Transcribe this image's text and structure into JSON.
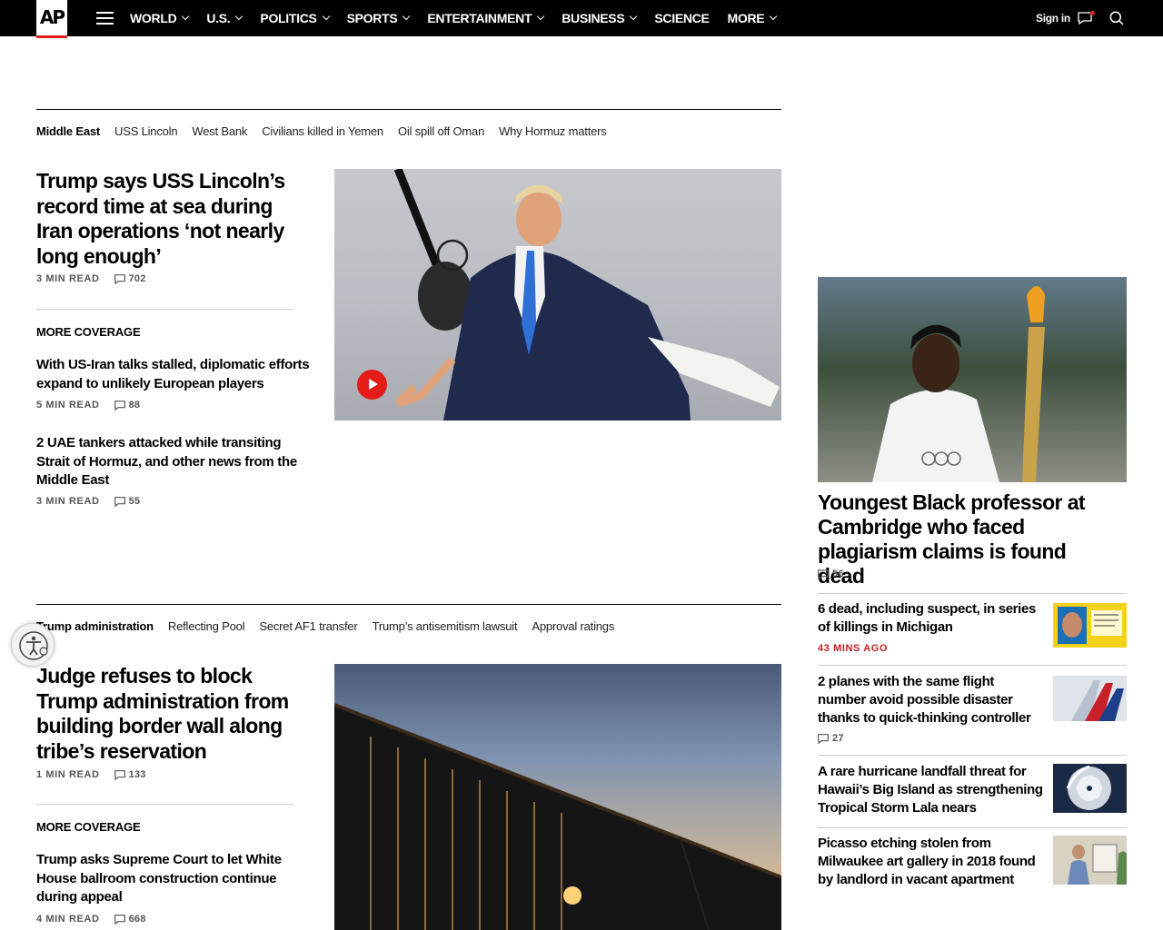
{
  "brand": {
    "logo_text": "AP",
    "accent": "#e41b17"
  },
  "nav": {
    "items": [
      {
        "label": "WORLD",
        "dropdown": true
      },
      {
        "label": "U.S.",
        "dropdown": true
      },
      {
        "label": "POLITICS",
        "dropdown": true
      },
      {
        "label": "SPORTS",
        "dropdown": true
      },
      {
        "label": "ENTERTAINMENT",
        "dropdown": true
      },
      {
        "label": "BUSINESS",
        "dropdown": true
      },
      {
        "label": "SCIENCE",
        "dropdown": false
      },
      {
        "label": "MORE",
        "dropdown": true
      }
    ],
    "signin": "Sign in",
    "icons": [
      "menu-icon",
      "chat-icon",
      "search-icon"
    ]
  },
  "section1": {
    "tags": [
      "Middle East",
      "USS Lincoln",
      "West Bank",
      "Civilians killed in Yemen",
      "Oil spill off Oman",
      "Why Hormuz matters"
    ],
    "lead": {
      "title": "Trump says USS Lincoln’s record time at sea during Iran operations ‘not nearly long enough’",
      "read": "3 MIN READ",
      "comments": "702"
    },
    "more_coverage": "MORE COVERAGE",
    "related": [
      {
        "title": "With US-Iran talks stalled, diplomatic efforts expand to unlikely European players",
        "read": "5 MIN READ",
        "comments": "88"
      },
      {
        "title": "2 UAE tankers attacked while transiting Strait of Hormuz, and other news from the Middle East",
        "read": "3 MIN READ",
        "comments": "55"
      }
    ]
  },
  "section2": {
    "tags": [
      "Trump administration",
      "Reflecting Pool",
      "Secret AF1 transfer",
      "Trump’s antisemitism lawsuit",
      "Approval ratings"
    ],
    "lead": {
      "title": "Judge refuses to block Trump administration from building border wall along tribe’s reservation",
      "read": "1 MIN READ",
      "comments": "133"
    },
    "more_coverage": "MORE COVERAGE",
    "related": [
      {
        "title": "Trump asks Supreme Court to let White House ballroom construction continue during appeal",
        "read": "4 MIN READ",
        "comments": "668"
      }
    ]
  },
  "right": {
    "lead": {
      "title": "Youngest Black professor at Cambridge who faced plagiarism claims is found dead",
      "comments": "56"
    },
    "items": [
      {
        "title": "6 dead, including suspect, in series of killings in Michigan",
        "time": "43 MINS AGO"
      },
      {
        "title": "2 planes with the same flight number avoid possible disaster thanks to quick-thinking controller",
        "comments": "27"
      },
      {
        "title": "A rare hurricane landfall threat for Hawaii’s Big Island as strengthening Tropical Storm Lala nears"
      },
      {
        "title": "Picasso etching stolen from Milwaukee art gallery in 2018 found by landlord in vacant apartment"
      }
    ]
  }
}
